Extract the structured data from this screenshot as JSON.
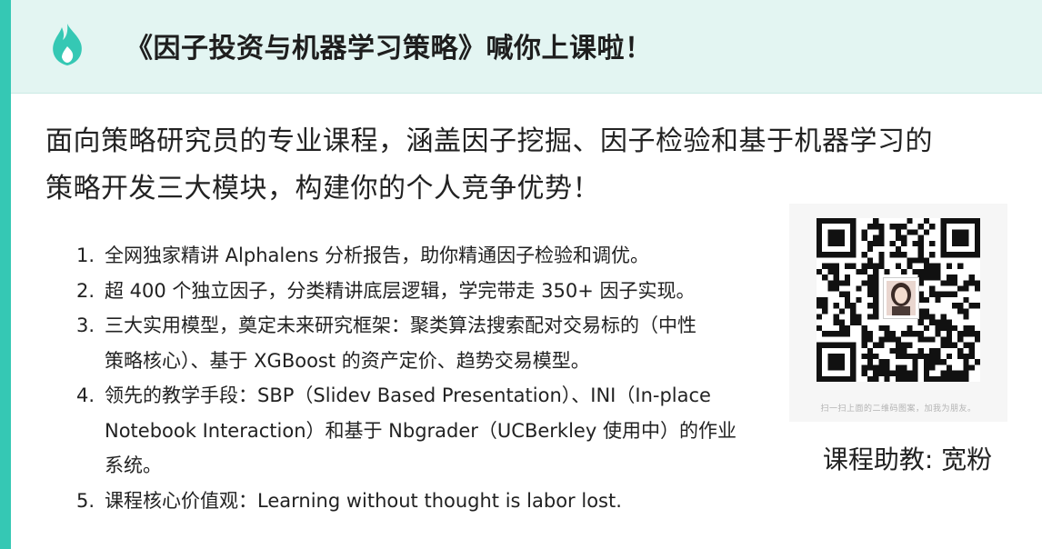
{
  "header": {
    "title": "《因子投资与机器学习策略》喊你上课啦！",
    "icon": "flame-icon",
    "accent_color": "#35c8b4",
    "background_color": "#e3f5f2"
  },
  "lead": {
    "line1": "面向策略研究员的专业课程，涵盖因子挖掘、因子检验和基于机器学习的",
    "line2": "策略开发三大模块，构建你的个人竞争优势！"
  },
  "features": [
    {
      "num": "1.",
      "lines": [
        "全网独家精讲 Alphalens 分析报告，助你精通因子检验和调优。"
      ]
    },
    {
      "num": "2.",
      "lines": [
        "超 400 个独立因子，分类精讲底层逻辑，学完带走 350+ 因子实现。"
      ]
    },
    {
      "num": "3.",
      "lines": [
        "三大实用模型，奠定未来研究框架：聚类算法搜索配对交易标的（中性",
        "策略核心）、基于 XGBoost 的资产定价、趋势交易模型。"
      ]
    },
    {
      "num": "4.",
      "lines": [
        "领先的教学手段：SBP（Slidev Based Presentation）、INI（In-place",
        "Notebook Interaction）和基于 Nbgrader（UCBerkley 使用中）的作业",
        "系统。"
      ]
    },
    {
      "num": "5.",
      "lines": [
        "课程核心价值观：Learning without thought is labor lost."
      ]
    }
  ],
  "qr": {
    "hint": "扫一扫上面的二维码图案，加我为朋友。"
  },
  "assistant_label": "课程助教: 宽粉"
}
